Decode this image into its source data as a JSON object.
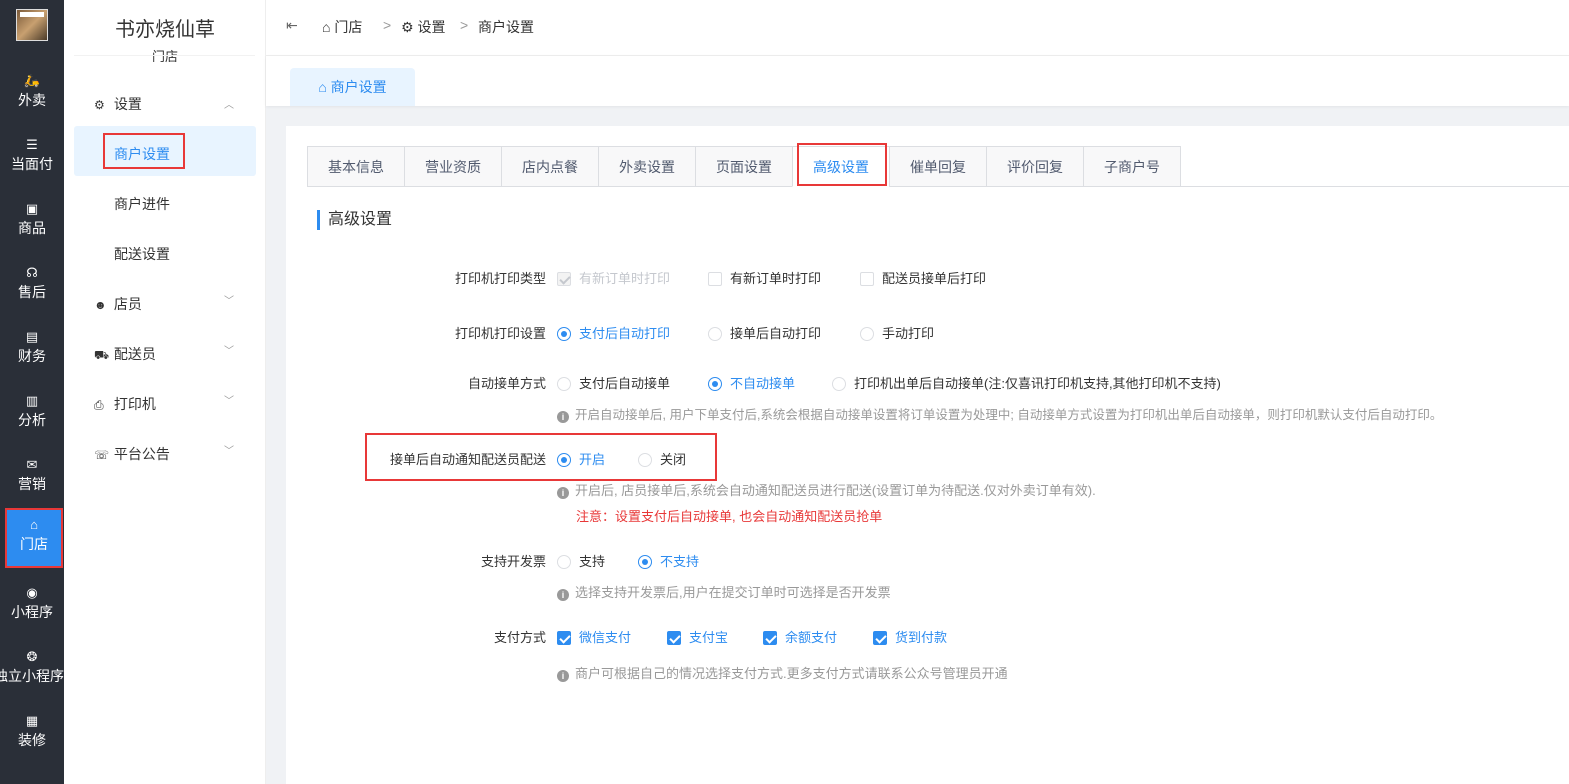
{
  "rail": {
    "items": [
      {
        "icon": "scooter-icon",
        "glyph": "🛵",
        "label": "外卖"
      },
      {
        "icon": "list-icon",
        "glyph": "☰",
        "label": "当面付"
      },
      {
        "icon": "gift-box-icon",
        "glyph": "▣",
        "label": "商品"
      },
      {
        "icon": "headset-icon",
        "glyph": "☊",
        "label": "售后"
      },
      {
        "icon": "finance-icon",
        "glyph": "▤",
        "label": "财务"
      },
      {
        "icon": "bar-chart-icon",
        "glyph": "▥",
        "label": "分析"
      },
      {
        "icon": "gift-icon",
        "glyph": "✉",
        "label": "营销"
      },
      {
        "icon": "store-icon",
        "glyph": "⌂",
        "label": "门店"
      },
      {
        "icon": "wechat-icon",
        "glyph": "◉",
        "label": "小程序"
      },
      {
        "icon": "miniapp-icon",
        "glyph": "❂",
        "label": "独立小程序"
      },
      {
        "icon": "decor-icon",
        "glyph": "▦",
        "label": "装修"
      }
    ],
    "active_index": 7
  },
  "subnav": {
    "store_name": "书亦烧仙草",
    "store_sub": "门店",
    "groups": {
      "settings": {
        "label": "设置",
        "items": [
          "商户设置",
          "商户进件",
          "配送设置"
        ]
      },
      "staff": {
        "label": "店员"
      },
      "courier": {
        "label": "配送员"
      },
      "printer": {
        "label": "打印机"
      },
      "notice": {
        "label": "平台公告"
      }
    }
  },
  "breadcrumb": [
    "门店",
    "设置",
    "商户设置"
  ],
  "page_tab": "商户设置",
  "tabs": [
    "基本信息",
    "营业资质",
    "店内点餐",
    "外卖设置",
    "页面设置",
    "高级设置",
    "催单回复",
    "评价回复",
    "子商户号"
  ],
  "selected_tab": "高级设置",
  "section_title": "高级设置",
  "form": {
    "print_type": {
      "label": "打印机打印类型",
      "options": [
        "有新订单时打印",
        "有新订单时打印",
        "配送员接单后打印"
      ]
    },
    "print_setting": {
      "label": "打印机打印设置",
      "options": [
        "支付后自动打印",
        "接单后自动打印",
        "手动打印"
      ],
      "selected": "支付后自动打印"
    },
    "auto_accept": {
      "label": "自动接单方式",
      "options": [
        "支付后自动接单",
        "不自动接单",
        "打印机出单后自动接单(注:仅喜讯打印机支持,其他打印机不支持)"
      ],
      "selected": "不自动接单",
      "hint": "开启自动接单后, 用户下单支付后,系统会根据自动接单设置将订单设置为处理中; 自动接单方式设置为打印机出单后自动接单，则打印机默认支付后自动打印。"
    },
    "notify_courier": {
      "label": "接单后自动通知配送员配送",
      "options": [
        "开启",
        "关闭"
      ],
      "selected": "开启",
      "hint": "开启后, 店员接单后,系统会自动通知配送员进行配送(设置订单为待配送.仅对外卖订单有效).",
      "warning": "注意：设置支付后自动接单, 也会自动通知配送员抢单"
    },
    "invoice": {
      "label": "支持开发票",
      "options": [
        "支持",
        "不支持"
      ],
      "selected": "不支持",
      "hint": "选择支持开发票后,用户在提交订单时可选择是否开发票"
    },
    "payment": {
      "label": "支付方式",
      "options": [
        "微信支付",
        "支付宝",
        "余额支付",
        "货到付款"
      ],
      "hint": "商户可根据自己的情况选择支付方式.更多支付方式请联系公众号管理员开通"
    }
  },
  "colors": {
    "accent": "#2d8cf0",
    "highlight": "#e83838",
    "rail": "#2a2f38"
  }
}
